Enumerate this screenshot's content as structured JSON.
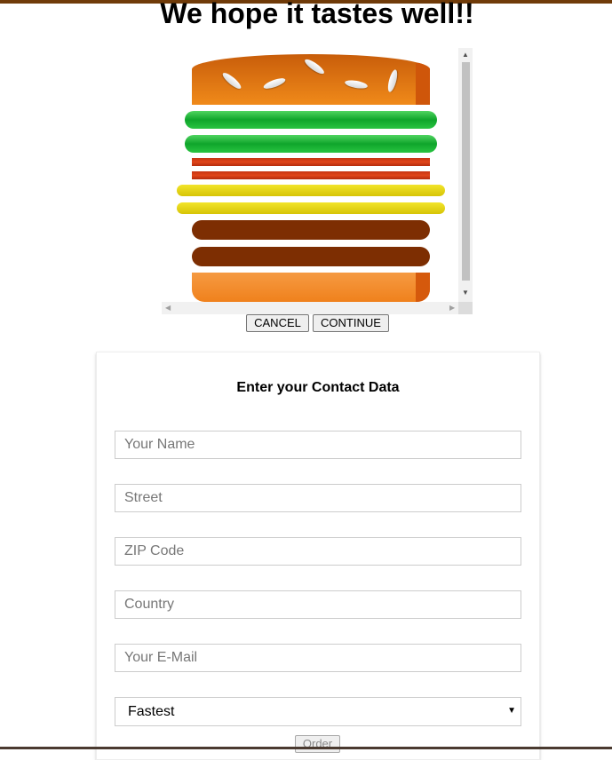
{
  "page": {
    "heading": "We hope it tastes well!!",
    "accent_color": "#703b09"
  },
  "burger": {
    "layers": [
      "bread-top",
      "salad",
      "salad",
      "bacon",
      "bacon",
      "cheese",
      "cheese",
      "meat",
      "meat",
      "bread-bottom"
    ]
  },
  "preview_actions": {
    "cancel_label": "CANCEL",
    "continue_label": "CONTINUE"
  },
  "contact": {
    "title": "Enter your Contact Data",
    "fields": {
      "name_placeholder": "Your Name",
      "street_placeholder": "Street",
      "zip_placeholder": "ZIP Code",
      "country_placeholder": "Country",
      "email_placeholder": "Your E-Mail"
    },
    "delivery_method": {
      "selected": "Fastest"
    },
    "order_label": "Order"
  }
}
